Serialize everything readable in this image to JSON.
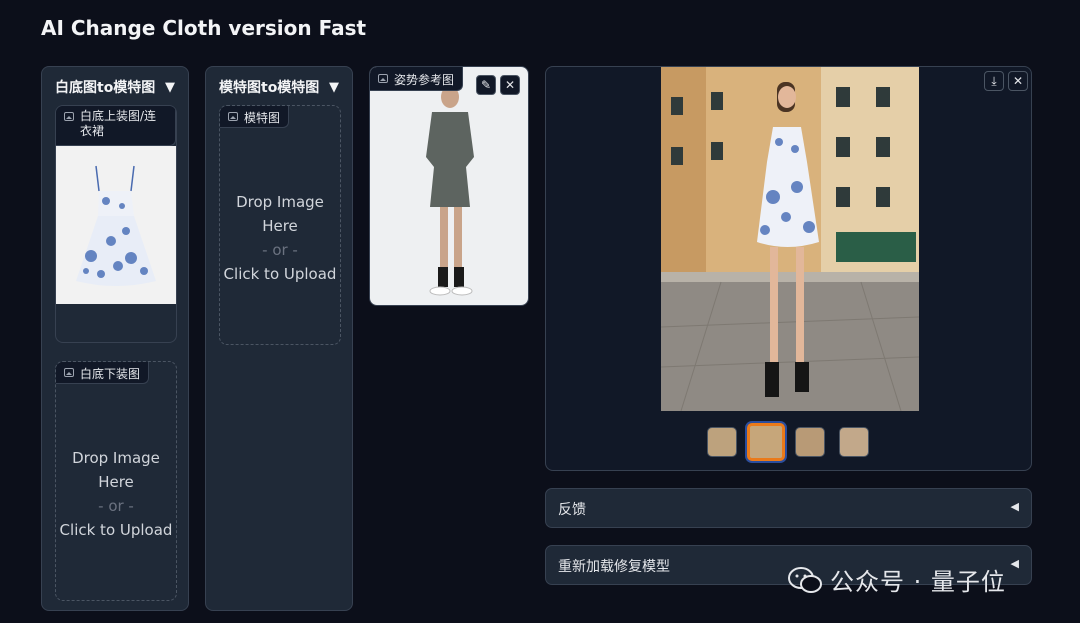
{
  "app": {
    "title": "AI Change Cloth version Fast"
  },
  "panel_white_to_model": {
    "title": "白底图to模特图",
    "caret": "▼",
    "top_upload": {
      "label": "白底上装图/连衣裙"
    },
    "bottom_upload": {
      "label": "白底下装图",
      "drop_text": "Drop Image Here",
      "or_text": "- or -",
      "click_text": "Click to Upload"
    }
  },
  "panel_model_to_model": {
    "title": "模特图to模特图",
    "caret": "▼",
    "upload": {
      "label": "模特图",
      "drop_text": "Drop Image Here",
      "or_text": "- or -",
      "click_text": "Click to Upload"
    }
  },
  "pose_reference": {
    "label": "姿势参考图",
    "edit_icon": "pencil-icon",
    "close_icon": "close-icon"
  },
  "output_gallery": {
    "download_icon": "download-icon",
    "close_icon": "close-icon",
    "thumbnail_count": 4,
    "selected_index": 1
  },
  "accordions": [
    {
      "label": "反馈",
      "icon": "◀"
    },
    {
      "label": "重新加载修复模型",
      "icon": "◀"
    }
  ],
  "watermark": {
    "text": "公众号 · 量子位"
  },
  "colors": {
    "background": "#0c0f1a",
    "panel": "#1f2937",
    "border": "#374151",
    "selected_thumb": "#ea7a1a"
  }
}
